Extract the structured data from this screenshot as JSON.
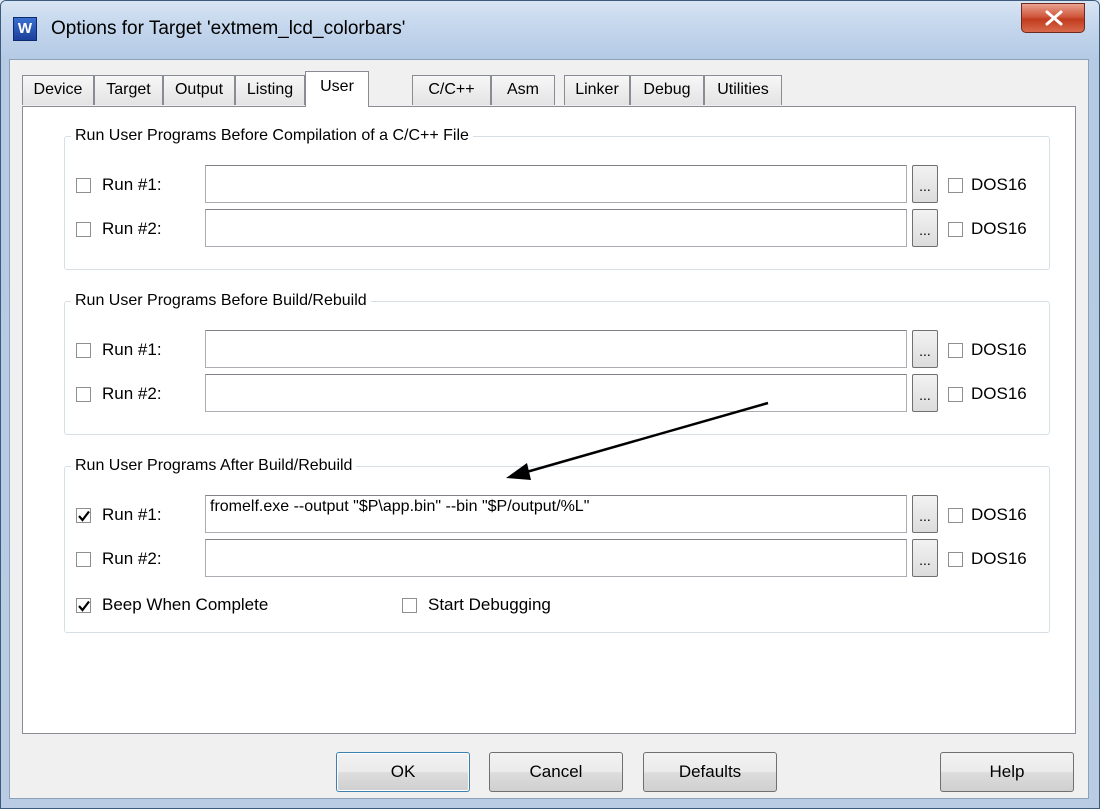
{
  "window": {
    "title": "Options for Target 'extmem_lcd_colorbars'",
    "app_icon_glyph": "W"
  },
  "tabs": [
    {
      "label": "Device"
    },
    {
      "label": "Target"
    },
    {
      "label": "Output"
    },
    {
      "label": "Listing"
    },
    {
      "label": "User",
      "active": true
    },
    {
      "label": "C/C++"
    },
    {
      "label": "Asm"
    },
    {
      "label": "Linker"
    },
    {
      "label": "Debug"
    },
    {
      "label": "Utilities"
    }
  ],
  "groups": [
    {
      "legend": "Run User Programs Before Compilation of a C/C++ File",
      "rows": [
        {
          "label": "Run #1:",
          "checked": false,
          "value": "",
          "browse": "...",
          "dos_label": "DOS16",
          "dos_checked": false
        },
        {
          "label": "Run #2:",
          "checked": false,
          "value": "",
          "browse": "...",
          "dos_label": "DOS16",
          "dos_checked": false
        }
      ]
    },
    {
      "legend": "Run User Programs Before Build/Rebuild",
      "rows": [
        {
          "label": "Run #1:",
          "checked": false,
          "value": "",
          "browse": "...",
          "dos_label": "DOS16",
          "dos_checked": false
        },
        {
          "label": "Run #2:",
          "checked": false,
          "value": "",
          "browse": "...",
          "dos_label": "DOS16",
          "dos_checked": false
        }
      ]
    },
    {
      "legend": "Run User Programs After Build/Rebuild",
      "rows": [
        {
          "label": "Run #1:",
          "checked": true,
          "value": "fromelf.exe --output \"$P\\app.bin\" --bin \"$P/output/%L\"",
          "browse": "...",
          "dos_label": "DOS16",
          "dos_checked": false
        },
        {
          "label": "Run #2:",
          "checked": false,
          "value": "",
          "browse": "...",
          "dos_label": "DOS16",
          "dos_checked": false
        }
      ],
      "beep_label": "Beep When Complete",
      "beep_checked": true,
      "start_debug_label": "Start Debugging",
      "start_debug_checked": false
    }
  ],
  "buttons": {
    "ok": "OK",
    "cancel": "Cancel",
    "defaults": "Defaults",
    "help": "Help"
  },
  "colors": {
    "arrow": "#000000",
    "close_button": "#c94a2c"
  }
}
